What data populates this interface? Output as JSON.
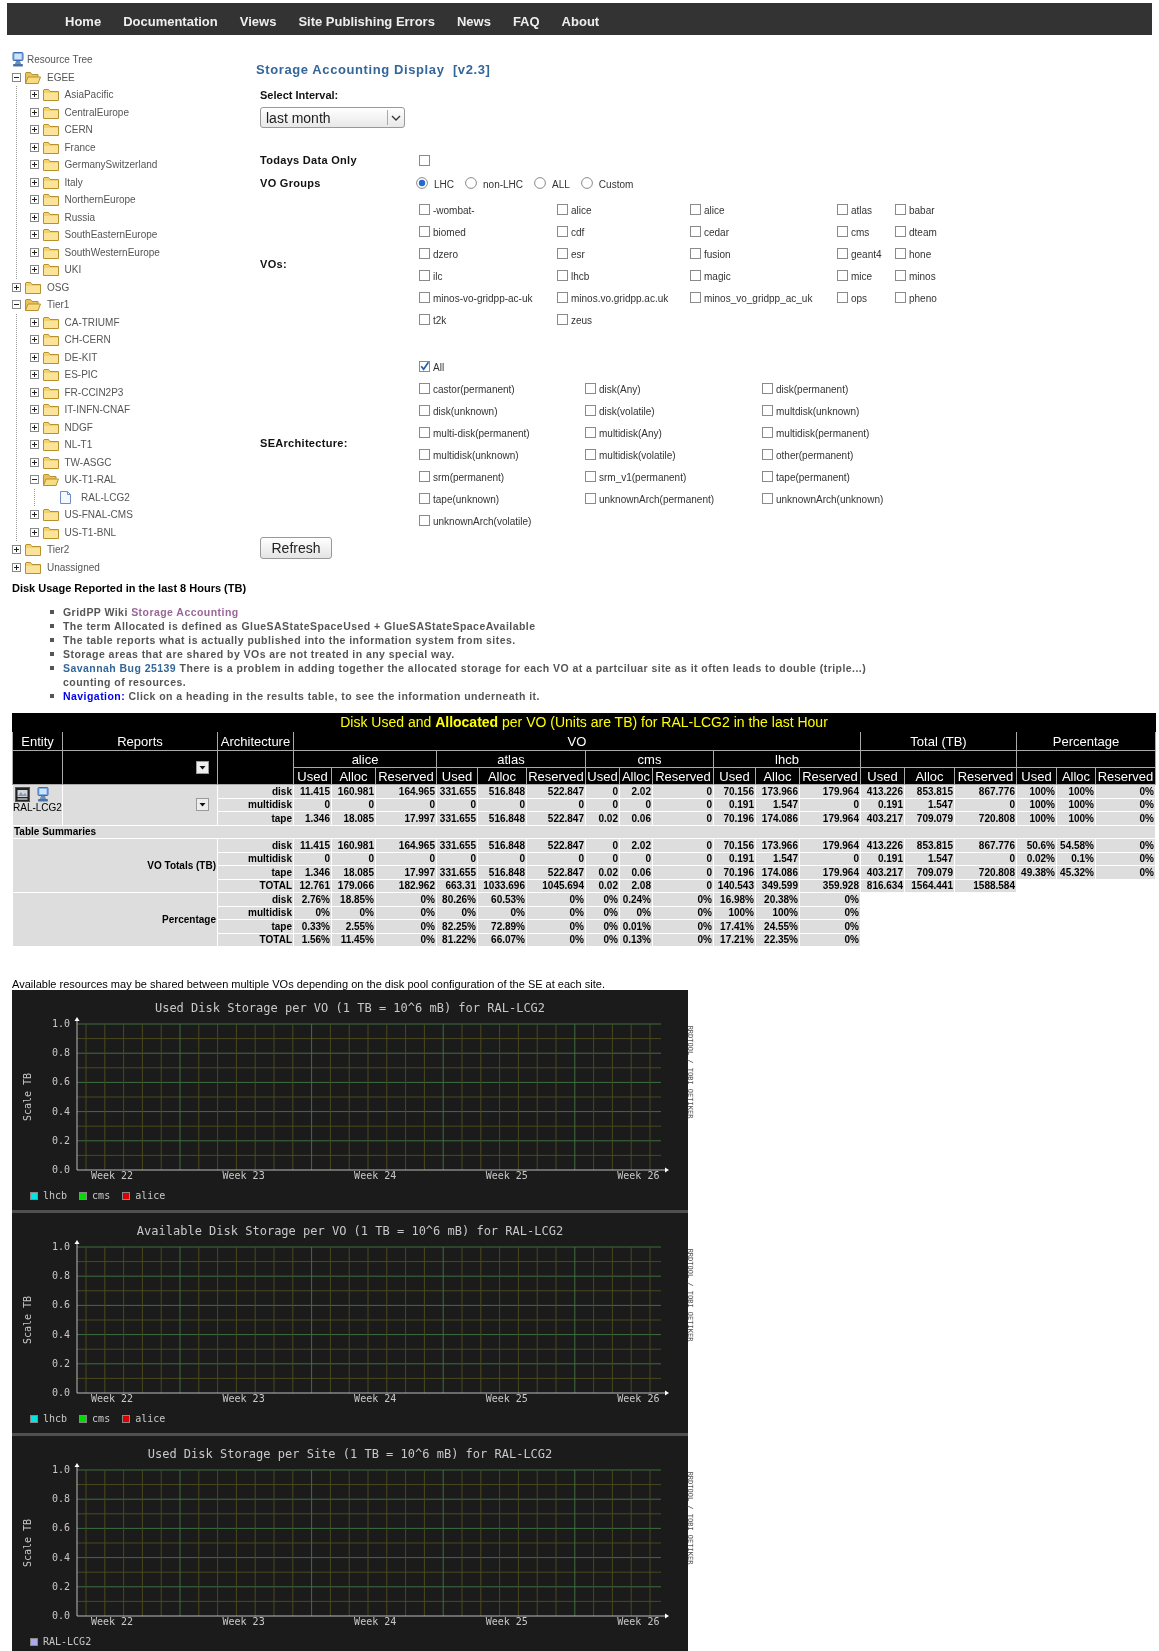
{
  "nav": [
    "Home",
    "Documentation",
    "Views",
    "Site Publishing Errors",
    "News",
    "FAQ",
    "About"
  ],
  "tree": {
    "root": "Resource Tree",
    "items": [
      {
        "label": "EGEE",
        "kind": "folder",
        "expanded": true,
        "children": [
          {
            "label": "AsiaPacific",
            "kind": "folder",
            "expanded": false
          },
          {
            "label": "CentralEurope",
            "kind": "folder",
            "expanded": false
          },
          {
            "label": "CERN",
            "kind": "folder",
            "expanded": false
          },
          {
            "label": "France",
            "kind": "folder",
            "expanded": false
          },
          {
            "label": "GermanySwitzerland",
            "kind": "folder",
            "expanded": false
          },
          {
            "label": "Italy",
            "kind": "folder",
            "expanded": false
          },
          {
            "label": "NorthernEurope",
            "kind": "folder",
            "expanded": false
          },
          {
            "label": "Russia",
            "kind": "folder",
            "expanded": false
          },
          {
            "label": "SouthEasternEurope",
            "kind": "folder",
            "expanded": false
          },
          {
            "label": "SouthWesternEurope",
            "kind": "folder",
            "expanded": false
          },
          {
            "label": "UKI",
            "kind": "folder",
            "expanded": false
          }
        ]
      },
      {
        "label": "OSG",
        "kind": "folder",
        "expanded": false
      },
      {
        "label": "Tier1",
        "kind": "folder",
        "expanded": true,
        "children": [
          {
            "label": "CA-TRIUMF",
            "kind": "folder",
            "expanded": false
          },
          {
            "label": "CH-CERN",
            "kind": "folder",
            "expanded": false
          },
          {
            "label": "DE-KIT",
            "kind": "folder",
            "expanded": false
          },
          {
            "label": "ES-PIC",
            "kind": "folder",
            "expanded": false
          },
          {
            "label": "FR-CCIN2P3",
            "kind": "folder",
            "expanded": false
          },
          {
            "label": "IT-INFN-CNAF",
            "kind": "folder",
            "expanded": false
          },
          {
            "label": "NDGF",
            "kind": "folder",
            "expanded": false
          },
          {
            "label": "NL-T1",
            "kind": "folder",
            "expanded": false
          },
          {
            "label": "TW-ASGC",
            "kind": "folder",
            "expanded": false
          },
          {
            "label": "UK-T1-RAL",
            "kind": "folder",
            "expanded": true,
            "children": [
              {
                "label": "RAL-LCG2",
                "kind": "site"
              }
            ]
          },
          {
            "label": "US-FNAL-CMS",
            "kind": "folder",
            "expanded": false
          },
          {
            "label": "US-T1-BNL",
            "kind": "folder",
            "expanded": false
          }
        ]
      },
      {
        "label": "Tier2",
        "kind": "folder",
        "expanded": false
      },
      {
        "label": "Unassigned",
        "kind": "folder",
        "expanded": false
      }
    ]
  },
  "form": {
    "title": "Storage Accounting Display  [v2.3]",
    "interval_label": "Select Interval:",
    "interval_value": "last month",
    "todays_label": "Todays Data Only",
    "todays_checked": false,
    "vo_groups_label": "VO Groups",
    "vo_groups": [
      {
        "label": "LHC",
        "selected": true
      },
      {
        "label": "non-LHC",
        "selected": false
      },
      {
        "label": "ALL",
        "selected": false
      },
      {
        "label": "Custom",
        "selected": false
      }
    ],
    "vos_label": "VOs:",
    "vos": [
      {
        "label": "-wombat-",
        "checked": false
      },
      {
        "label": "alice",
        "checked": false
      },
      {
        "label": "alice",
        "checked": false
      },
      {
        "label": "atlas",
        "checked": false
      },
      {
        "label": "babar",
        "checked": false
      },
      {
        "label": "biomed",
        "checked": false
      },
      {
        "label": "cdf",
        "checked": false
      },
      {
        "label": "cedar",
        "checked": false
      },
      {
        "label": "cms",
        "checked": false
      },
      {
        "label": "dteam",
        "checked": false
      },
      {
        "label": "dzero",
        "checked": false
      },
      {
        "label": "esr",
        "checked": false
      },
      {
        "label": "fusion",
        "checked": false
      },
      {
        "label": "geant4",
        "checked": false
      },
      {
        "label": "hone",
        "checked": false
      },
      {
        "label": "ilc",
        "checked": false
      },
      {
        "label": "lhcb",
        "checked": false
      },
      {
        "label": "magic",
        "checked": false
      },
      {
        "label": "mice",
        "checked": false
      },
      {
        "label": "minos",
        "checked": false
      },
      {
        "label": "minos-vo-gridpp-ac-uk",
        "checked": false
      },
      {
        "label": "minos.vo.gridpp.ac.uk",
        "checked": false
      },
      {
        "label": "minos_vo_gridpp_ac_uk",
        "checked": false
      },
      {
        "label": "ops",
        "checked": false
      },
      {
        "label": "pheno",
        "checked": false
      },
      {
        "label": "t2k",
        "checked": false
      },
      {
        "label": "zeus",
        "checked": false
      }
    ],
    "se_label": "SEArchitecture:",
    "se_all": {
      "label": "All",
      "checked": true
    },
    "se_options": [
      {
        "label": "castor(permanent)",
        "checked": false
      },
      {
        "label": "disk(Any)",
        "checked": false
      },
      {
        "label": "disk(permanent)",
        "checked": false
      },
      {
        "label": "disk(unknown)",
        "checked": false
      },
      {
        "label": "disk(volatile)",
        "checked": false
      },
      {
        "label": "multdisk(unknown)",
        "checked": false
      },
      {
        "label": "multi-disk(permanent)",
        "checked": false
      },
      {
        "label": "multidisk(Any)",
        "checked": false
      },
      {
        "label": "multidisk(permanent)",
        "checked": false
      },
      {
        "label": "multidisk(unknown)",
        "checked": false
      },
      {
        "label": "multidisk(volatile)",
        "checked": false
      },
      {
        "label": "other(permanent)",
        "checked": false
      },
      {
        "label": "srm(permanent)",
        "checked": false
      },
      {
        "label": "srm_v1(permanent)",
        "checked": false
      },
      {
        "label": "tape(permanent)",
        "checked": false
      },
      {
        "label": "tape(unknown)",
        "checked": false
      },
      {
        "label": "unknownArch(permanent)",
        "checked": false
      },
      {
        "label": "unknownArch(unknown)",
        "checked": false
      },
      {
        "label": "unknownArch(volatile)",
        "checked": false
      }
    ],
    "refresh": "Refresh"
  },
  "notes_heading": "Disk Usage Reported in the last 8 Hours (TB)",
  "notes": [
    {
      "parts": [
        {
          "text": "GridPP Wiki "
        },
        {
          "link": "Storage Accounting",
          "kind": "visited"
        }
      ]
    },
    {
      "parts": [
        {
          "text": "The term Allocated is defined as GlueSAStateSpaceUsed + GlueSAStateSpaceAvailable"
        }
      ]
    },
    {
      "parts": [
        {
          "text": "The table reports what is actually published into the information system from sites."
        }
      ]
    },
    {
      "parts": [
        {
          "text": "Storage areas that are shared by VOs are not treated in any special way."
        }
      ]
    },
    {
      "parts": [
        {
          "link": "Savannah Bug 25139",
          "kind": "link"
        },
        {
          "text": " There is a problem in adding together the allocated storage for each VO at a partciluar site as it often leads to double (triple...) counting of resources."
        }
      ]
    },
    {
      "parts": [
        {
          "link": "Navigation:",
          "kind": "navigation"
        },
        {
          "text": " Click on a heading in the results table, to see the information underneath it."
        }
      ]
    }
  ],
  "table": {
    "title": "Disk Used and **Allocated** per VO (Units are TB) for RAL-LCG2 in the last Hour",
    "header_tree": [
      {
        "label": "Entity"
      },
      {
        "label": "Reports"
      },
      {
        "label": "Architecture"
      },
      {
        "label": "VO",
        "children": [
          {
            "label": "alice",
            "children": [
              {
                "label": "Used"
              },
              {
                "label": "Alloc"
              },
              {
                "label": "Reserved"
              }
            ]
          },
          {
            "label": "atlas",
            "children": [
              {
                "label": "Used"
              },
              {
                "label": "Alloc"
              },
              {
                "label": "Reserved"
              }
            ]
          },
          {
            "label": "cms",
            "children": [
              {
                "label": "Used"
              },
              {
                "label": "Alloc"
              },
              {
                "label": "Reserved"
              }
            ]
          },
          {
            "label": "lhcb",
            "children": [
              {
                "label": "Used"
              },
              {
                "label": "Alloc"
              },
              {
                "label": "Reserved"
              }
            ]
          }
        ]
      },
      {
        "label": "Total (TB)",
        "children": [
          {
            "label": "Used"
          },
          {
            "label": "Alloc"
          },
          {
            "label": "Reserved"
          }
        ]
      },
      {
        "label": "Percentage",
        "children": [
          {
            "label": "Used"
          },
          {
            "label": "Alloc"
          },
          {
            "label": "Reserved"
          }
        ]
      }
    ],
    "entity": "RAL-LCG2",
    "rows": [
      {
        "architecture": "disk",
        "cells": [
          "11.415",
          "160.981",
          "164.965",
          "331.655",
          "516.848",
          "522.847",
          "0",
          "2.02",
          "0",
          "70.156",
          "173.966",
          "179.964",
          "413.226",
          "853.815",
          "867.776",
          "100%",
          "100%",
          "0%"
        ]
      },
      {
        "architecture": "multidisk",
        "cells": [
          "0",
          "0",
          "0",
          "0",
          "0",
          "0",
          "0",
          "0",
          "0",
          "0.191",
          "1.547",
          "0",
          "0.191",
          "1.547",
          "0",
          "100%",
          "100%",
          "0%"
        ]
      },
      {
        "architecture": "tape",
        "cells": [
          "1.346",
          "18.085",
          "17.997",
          "331.655",
          "516.848",
          "522.847",
          "0.02",
          "0.06",
          "0",
          "70.196",
          "174.086",
          "179.964",
          "403.217",
          "709.079",
          "720.808",
          "100%",
          "100%",
          "0%"
        ]
      }
    ],
    "summaries_label": "Table Summaries",
    "groups": [
      {
        "label": "VO Totals (TB)",
        "rows": [
          {
            "architecture": "disk",
            "cells": [
              "11.415",
              "160.981",
              "164.965",
              "331.655",
              "516.848",
              "522.847",
              "0",
              "2.02",
              "0",
              "70.156",
              "173.966",
              "179.964",
              "413.226",
              "853.815",
              "867.776",
              "50.6%",
              "54.58%",
              "0%"
            ]
          },
          {
            "architecture": "multidisk",
            "cells": [
              "0",
              "0",
              "0",
              "0",
              "0",
              "0",
              "0",
              "0",
              "0",
              "0.191",
              "1.547",
              "0",
              "0.191",
              "1.547",
              "0",
              "0.02%",
              "0.1%",
              "0%"
            ]
          },
          {
            "architecture": "tape",
            "cells": [
              "1.346",
              "18.085",
              "17.997",
              "331.655",
              "516.848",
              "522.847",
              "0.02",
              "0.06",
              "0",
              "70.196",
              "174.086",
              "179.964",
              "403.217",
              "709.079",
              "720.808",
              "49.38%",
              "45.32%",
              "0%"
            ]
          },
          {
            "architecture": "TOTAL",
            "cells": [
              "12.761",
              "179.066",
              "182.962",
              "663.31",
              "1033.696",
              "1045.694",
              "0.02",
              "2.08",
              "0",
              "140.543",
              "349.599",
              "359.928",
              "816.634",
              "1564.441",
              "1588.584"
            ]
          }
        ]
      },
      {
        "label": "Percentage",
        "rows": [
          {
            "architecture": "disk",
            "cells": [
              "2.76%",
              "18.85%",
              "0%",
              "80.26%",
              "60.53%",
              "0%",
              "0%",
              "0.24%",
              "0%",
              "16.98%",
              "20.38%",
              "0%"
            ]
          },
          {
            "architecture": "multidisk",
            "cells": [
              "0%",
              "0%",
              "0%",
              "0%",
              "0%",
              "0%",
              "0%",
              "0%",
              "0%",
              "100%",
              "100%",
              "0%"
            ]
          },
          {
            "architecture": "tape",
            "cells": [
              "0.33%",
              "2.55%",
              "0%",
              "82.25%",
              "72.89%",
              "0%",
              "0%",
              "0.01%",
              "0%",
              "17.41%",
              "24.55%",
              "0%"
            ]
          },
          {
            "architecture": "TOTAL",
            "cells": [
              "1.56%",
              "11.45%",
              "0%",
              "81.22%",
              "66.07%",
              "0%",
              "0%",
              "0.13%",
              "0%",
              "17.21%",
              "22.35%",
              "0%"
            ]
          }
        ]
      }
    ]
  },
  "shared_note": "Available resources may be shared between multiple VOs depending on the disk pool configuration of the SE at each site.",
  "charts": [
    {
      "title": "Used Disk Storage per VO (1 TB = 10^6 mB) for RAL-LCG2",
      "y_label": "Scale TB",
      "y_ticks": [
        "1.0",
        "0.8",
        "0.6",
        "0.4",
        "0.2",
        "0.0"
      ],
      "x_labels": [
        "Week 22",
        "Week 23",
        "Week 24",
        "Week 25",
        "Week 26"
      ],
      "legend": [
        {
          "label": "lhcb",
          "color": "#00e5e5"
        },
        {
          "label": "cms",
          "color": "#00dd00"
        },
        {
          "label": "alice",
          "color": "#dd0000"
        }
      ],
      "credit": "RRDTOOL / TOBI OETIKER"
    },
    {
      "title": "Available Disk Storage per VO (1 TB = 10^6 mB) for RAL-LCG2",
      "y_label": "Scale TB",
      "y_ticks": [
        "1.0",
        "0.8",
        "0.6",
        "0.4",
        "0.2",
        "0.0"
      ],
      "x_labels": [
        "Week 22",
        "Week 23",
        "Week 24",
        "Week 25",
        "Week 26"
      ],
      "legend": [
        {
          "label": "lhcb",
          "color": "#00e5e5"
        },
        {
          "label": "cms",
          "color": "#00dd00"
        },
        {
          "label": "alice",
          "color": "#dd0000"
        }
      ],
      "credit": "RRDTOOL / TOBI OETIKER"
    },
    {
      "title": "Used Disk Storage per Site (1 TB = 10^6 mB) for RAL-LCG2",
      "y_label": "Scale TB",
      "y_ticks": [
        "1.0",
        "0.8",
        "0.6",
        "0.4",
        "0.2",
        "0.0"
      ],
      "x_labels": [
        "Week 22",
        "Week 23",
        "Week 24",
        "Week 25",
        "Week 26"
      ],
      "legend": [
        {
          "label": "RAL-LCG2",
          "color": "#aaaaee"
        }
      ],
      "credit": "RRDTOOL / TOBI OETIKER"
    }
  ]
}
